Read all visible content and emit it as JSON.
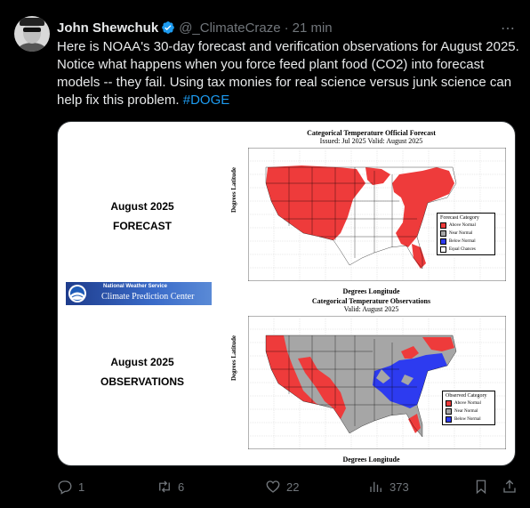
{
  "author": {
    "name": "John Shewchuk",
    "handle": "@_ClimateCraze",
    "separator": "·",
    "time": "21 min"
  },
  "post": {
    "text": "Here is NOAA's 30-day forecast and verification observations for August 2025.  Notice what happens when you force feed plant food (CO2) into forecast models -- they fail.  Using tax monies for real science versus junk science can help fix this problem.",
    "hashtag": "#DOGE"
  },
  "media": {
    "forecast_label": [
      "August 2025",
      "FORECAST"
    ],
    "observations_label": [
      "August 2025",
      "OBSERVATIONS"
    ],
    "nws": {
      "line1": "National Weather Service",
      "line2": "Climate Prediction Center"
    },
    "forecast_map": {
      "title": "Categorical Temperature Official Forecast",
      "subtitle": "Issued: Jul 2025 Valid: August 2025",
      "ylabel": "Degrees Latitude",
      "xlabel": "Degrees Longitude",
      "legend_title": "Forecast Category",
      "legend": [
        "Above Normal",
        "Near Normal",
        "Below Normal",
        "Equal Chances"
      ]
    },
    "obs_map": {
      "title": "Categorical Temperature Observations",
      "subtitle": "Valid: August 2025",
      "ylabel": "Degrees Latitude",
      "xlabel": "Degrees Longitude",
      "legend_title": "Observed Category",
      "legend": [
        "Above Normal",
        "Near Normal",
        "Below Normal"
      ]
    },
    "colors": {
      "above": "#ee3b3b",
      "near": "#a6a6a6",
      "below": "#2d3bf0",
      "equal": "#ffffff"
    }
  },
  "actions": {
    "replies": "1",
    "reposts": "6",
    "likes": "22",
    "views": "373"
  },
  "colors": {
    "background": "#000000",
    "text": "#e7e9ea",
    "muted": "#71767b",
    "link": "#1d9bf0",
    "verified": "#1d9bf0"
  }
}
